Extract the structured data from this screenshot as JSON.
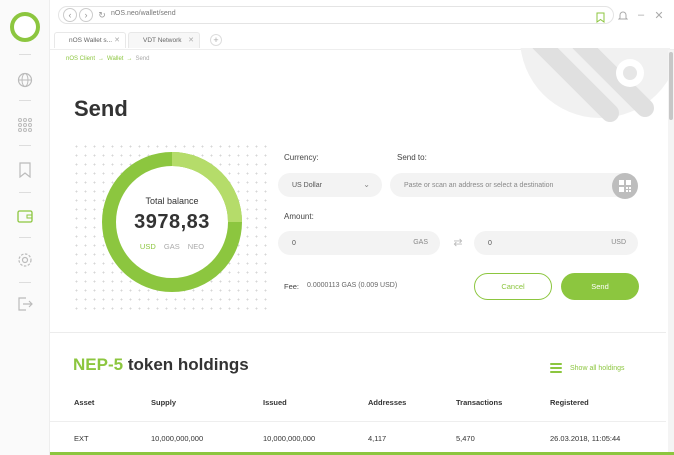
{
  "browser": {
    "url": "nOS.neo/wallet/send",
    "tabs": [
      {
        "label": "nOS Wallet s..."
      },
      {
        "label": "VDT Network"
      }
    ]
  },
  "breadcrumb": {
    "items": [
      "nOS Client",
      "Wallet",
      "Send"
    ]
  },
  "page": {
    "title": "Send"
  },
  "balance": {
    "label": "Total balance",
    "value": "3978,83",
    "currencies": [
      "USD",
      "GAS",
      "NEO"
    ],
    "selected_currency": "USD"
  },
  "form": {
    "currency_label": "Currency:",
    "currency_value": "US Dollar",
    "send_to_label": "Send to:",
    "send_to_placeholder": "Paste or scan an address or select a destination",
    "amount_label": "Amount:",
    "amount_gas_value": "0",
    "amount_gas_unit": "GAS",
    "amount_usd_value": "0",
    "amount_usd_unit": "USD",
    "fee_label": "Fee:",
    "fee_value": "0.0000113 GAS (0.009 USD)",
    "cancel_label": "Cancel",
    "send_label": "Send"
  },
  "holdings": {
    "title_accent": "NEP-5",
    "title_rest": "token holdings",
    "show_all_label": "Show all holdings",
    "columns": [
      "Asset",
      "Supply",
      "Issued",
      "Addresses",
      "Transactions",
      "Registered"
    ],
    "rows": [
      [
        "EXT",
        "10,000,000,000",
        "10,000,000,000",
        "4,117",
        "5,470",
        "26.03.2018, 11:05:44"
      ]
    ]
  },
  "colors": {
    "accent": "#8cc63f",
    "accent_light": "#b5dc6a"
  }
}
